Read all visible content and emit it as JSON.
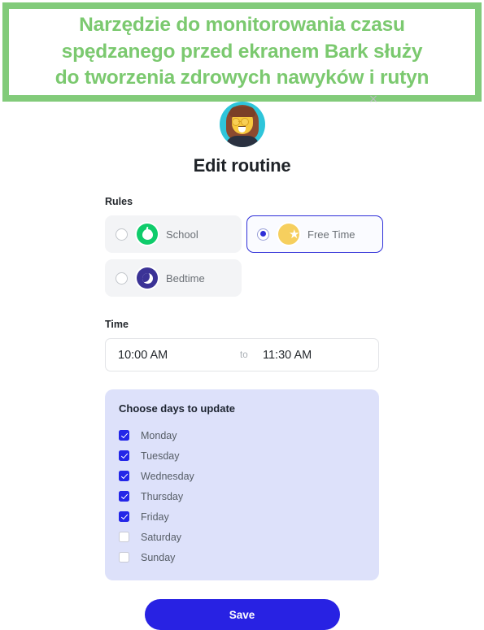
{
  "banner": {
    "text": "Narzędzie do monitorowania czasu\nspędzanego przed ekranem Bark służy\ndo tworzenia zdrowych nawyków i rutyn",
    "border_color": "#82cb7a",
    "text_color": "#7bc96f",
    "close_icon": "×"
  },
  "header": {
    "avatar_icon": "woman-with-glasses-avatar",
    "title": "Edit routine"
  },
  "rules": {
    "label": "Rules",
    "options": [
      {
        "label": "School",
        "icon": "apple-icon",
        "icon_color": "#0fcc6b",
        "selected": false
      },
      {
        "label": "Free Time",
        "icon": "star-icon",
        "icon_color": "#f6cf5e",
        "selected": true
      },
      {
        "label": "Bedtime",
        "icon": "moon-icon",
        "icon_color": "#3b3396",
        "selected": false
      }
    ],
    "selected_color": "#2f2fd8"
  },
  "time": {
    "label": "Time",
    "start": "10:00 AM",
    "separator": "to",
    "end": "11:30 AM"
  },
  "days": {
    "title": "Choose days to update",
    "panel_color": "#dde1fa",
    "checked_color": "#2426e8",
    "items": [
      {
        "label": "Monday",
        "checked": true
      },
      {
        "label": "Tuesday",
        "checked": true
      },
      {
        "label": "Wednesday",
        "checked": true
      },
      {
        "label": "Thursday",
        "checked": true
      },
      {
        "label": "Friday",
        "checked": true
      },
      {
        "label": "Saturday",
        "checked": false
      },
      {
        "label": "Sunday",
        "checked": false
      }
    ]
  },
  "footer": {
    "save_label": "Save",
    "save_color": "#2822e3"
  }
}
